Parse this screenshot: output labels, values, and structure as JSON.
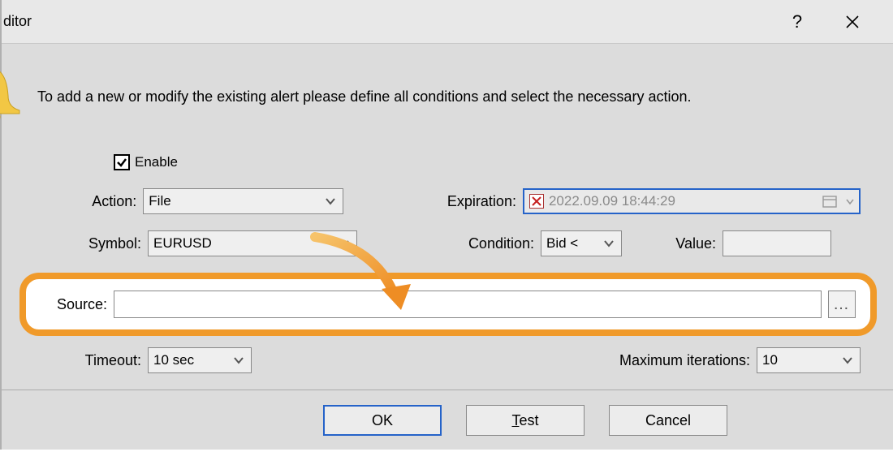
{
  "window": {
    "title": "ditor"
  },
  "intro": "To add a new or modify the existing alert please define all conditions and select the necessary action.",
  "enable": {
    "label": "Enable",
    "checked": true
  },
  "fields": {
    "action": {
      "label": "Action:",
      "value": "File"
    },
    "expiration": {
      "label": "Expiration:",
      "value": "2022.09.09 18:44:29"
    },
    "symbol": {
      "label": "Symbol:",
      "value": "EURUSD"
    },
    "condition": {
      "label": "Condition:",
      "value": "Bid <"
    },
    "value": {
      "label": "Value:",
      "value": ""
    },
    "source": {
      "label": "Source:",
      "value": "",
      "browse": "…"
    },
    "timeout": {
      "label": "Timeout:",
      "value": "10 sec"
    },
    "max_iterations": {
      "label": "Maximum iterations:",
      "value": "10"
    }
  },
  "buttons": {
    "ok": "OK",
    "test": "Test",
    "cancel": "Cancel"
  }
}
